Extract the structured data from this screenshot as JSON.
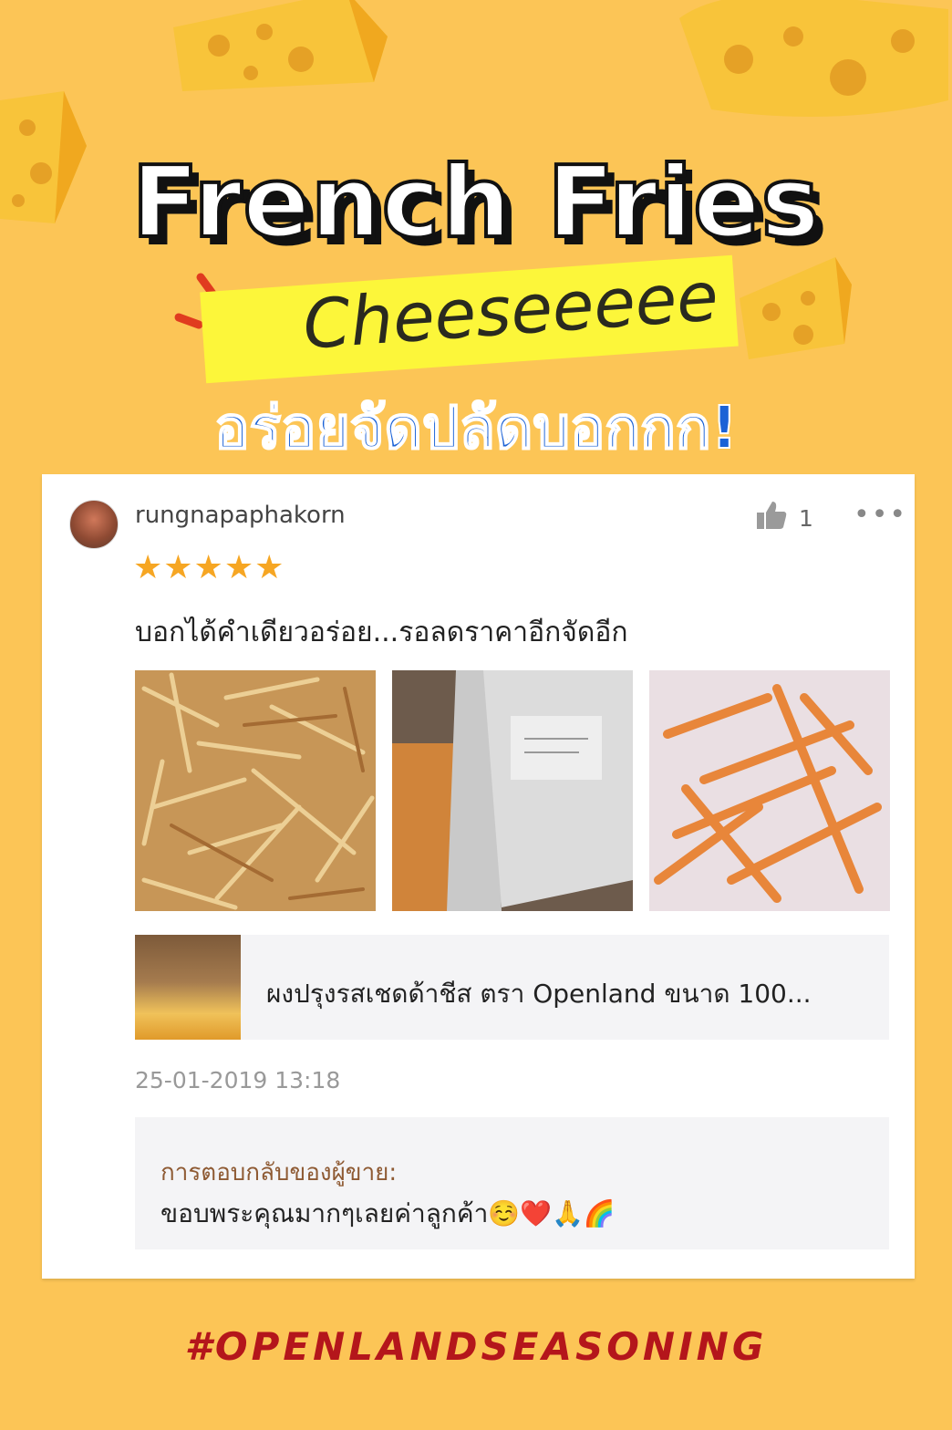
{
  "header": {
    "title": "French Fries",
    "subtitle": "Cheeseeeee",
    "tagline": "อร่อยจัดปลัดบอกกก!"
  },
  "review": {
    "username": "rungnapaphakorn",
    "like_count": "1",
    "rating": 5,
    "stars": "★★★★★",
    "text": "บอกได้คำเดียวอร่อย...รอลดราคาอีกจัดอีก",
    "product_name": "ผงปรุงรสเชดด้าชีส ตรา Openland ขนาด 100...",
    "timestamp": "25-01-2019 13:18",
    "seller_reply_label": "การตอบกลับของผู้ขาย:",
    "seller_reply_text": "ขอบพระคุณมากๆเลยค่าลูกค้า☺️❤️🙏🌈"
  },
  "footer": {
    "hashtag": "#OPENLANDSEASONING"
  },
  "colors": {
    "background": "#fcc556",
    "highlight": "#fcf63a",
    "tagline": "#1b62d6",
    "hashtag": "#b4161b",
    "stars": "#f6a623"
  },
  "icons": [
    "thumbs-up-icon",
    "more-icon",
    "star-icon"
  ]
}
